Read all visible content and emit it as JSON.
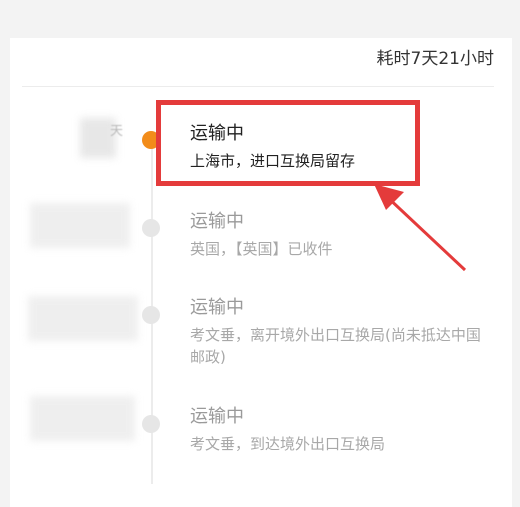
{
  "header": {
    "duration": "耗时7天21小时"
  },
  "timeline": [
    {
      "status": "运输中",
      "location": "上海市，进口互换局留存",
      "active": true,
      "left_label": "天"
    },
    {
      "status": "运输中",
      "location": "英国，【英国】已收件",
      "active": false
    },
    {
      "status": "运输中",
      "location": "考文垂，离开境外出口互换局(尚未抵达中国邮政)",
      "active": false
    },
    {
      "status": "运输中",
      "location": "考文垂，到达境外出口互换局",
      "active": false
    }
  ],
  "colors": {
    "active_dot": "#f28c1a",
    "inactive_dot": "#e6e6e6",
    "highlight": "#e43b3b",
    "active_text": "#222222",
    "inactive_text": "#9a9a9a"
  }
}
